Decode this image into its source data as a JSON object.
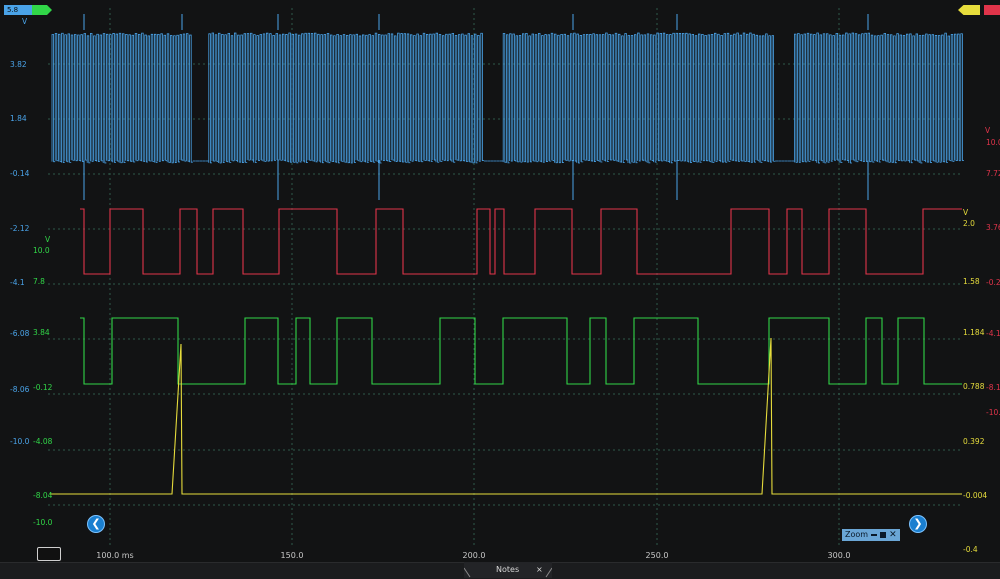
{
  "colors": {
    "background": "#121314",
    "grid": "#2f5a4a",
    "channel_a": "#4aa3e8",
    "channel_b": "#e0344a",
    "channel_c": "#31d648",
    "channel_d": "#e6dc3c"
  },
  "markers": {
    "top_left_value": "5.8",
    "top_left_unit": "V"
  },
  "axis_a": {
    "unit": "V",
    "ticks": [
      "3.82",
      "1.84",
      "-0.14",
      "-2.12",
      "-4.1",
      "-6.08",
      "-8.06",
      "-10.0"
    ]
  },
  "axis_c": {
    "unit": "V",
    "ticks": [
      "10.0",
      "7.8",
      "3.84",
      "-0.12",
      "-4.08",
      "-8.04",
      "-10.0"
    ]
  },
  "axis_b": {
    "unit": "V",
    "ticks": [
      "10.0",
      "7.72",
      "3.76",
      "-0.2",
      "-4.1",
      "-8.1",
      "-10."
    ]
  },
  "axis_d": {
    "unit": "V",
    "ticks": [
      "2.0",
      "1.58",
      "1.184",
      "0.788",
      "0.392",
      "-0.004",
      "-0.4"
    ]
  },
  "time_axis": {
    "ticks": [
      "100.0 ms",
      "150.0",
      "200.0",
      "250.0",
      "300.0"
    ]
  },
  "controls": {
    "zoom_label": "Zoom",
    "nav_left_glyph": "❮",
    "nav_right_glyph": "❯"
  },
  "notes_tab": {
    "label": "Notes",
    "close_glyph": "×"
  }
}
